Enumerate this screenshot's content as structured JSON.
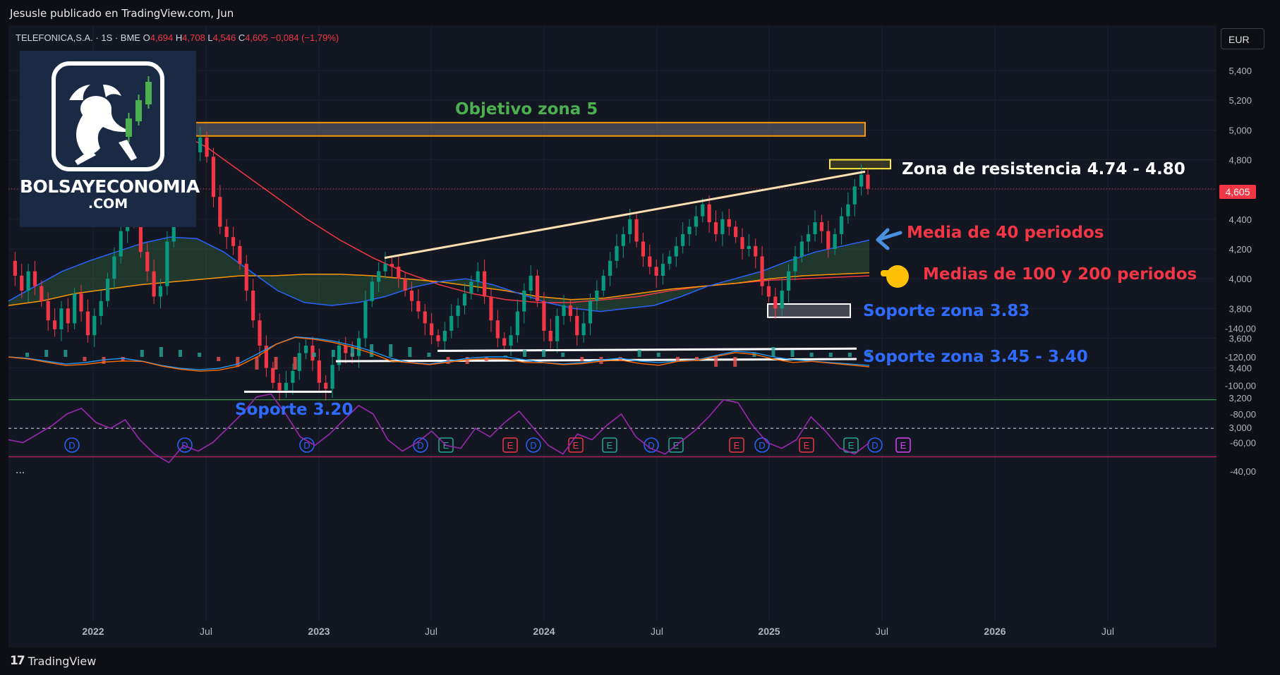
{
  "header": {
    "published_by": "Jesusle publicado en TradingView.com, Jun"
  },
  "footer": {
    "brand": "TradingView",
    "mark": "17"
  },
  "symbol": {
    "name": "TELEFONICA,S.A.",
    "interval": "1S",
    "exchange": "BME",
    "o_label": "O",
    "o": "4,694",
    "h_label": "H",
    "h": "4,708",
    "l_label": "L",
    "l": "4,546",
    "c_label": "C",
    "c": "4,605",
    "change": "−0,084 (−1,79%)"
  },
  "currency": "EUR",
  "last_price": "4,605",
  "logo": {
    "line1": "BOLSAYECONOMIA",
    "line2": ".COM"
  },
  "pane_menu": "...",
  "annotations": [
    {
      "id": "objetivo",
      "text": "Objetivo zona 5",
      "color": "#4caf50"
    },
    {
      "id": "resistencia",
      "text": "Zona de resistencia 4.74 - 4.80",
      "color": "#ffffff"
    },
    {
      "id": "media40",
      "text": "Media de 40 periodos",
      "color": "#f23645"
    },
    {
      "id": "medias100200",
      "text": "Medias de 100 y 200 periodos",
      "color": "#f23645"
    },
    {
      "id": "soporte383",
      "text": "Soporte zona 3.83",
      "color": "#2f6bff"
    },
    {
      "id": "soporte345",
      "text": "Soporte zona 3.45 - 3.40",
      "color": "#2f6bff"
    },
    {
      "id": "soporte320",
      "text": "Soporte 3.20",
      "color": "#2f6bff"
    }
  ],
  "chart_data": {
    "type": "candlestick",
    "colors": {
      "up": "#089981",
      "down": "#f23645",
      "sma40": "#2962ff",
      "sma100": "#ff9800",
      "sma200": "#f23645",
      "rsi": "#9c27b0",
      "macd": "#2196f3",
      "signal": "#ff6d00"
    },
    "price_axis": {
      "min": 3.0,
      "max": 5.4,
      "ticks": [
        "5,400",
        "5,200",
        "5,000",
        "4,800",
        "4,600",
        "4,400",
        "4,200",
        "4,000",
        "3,800",
        "3,600",
        "3,400",
        "3,200",
        "3,000"
      ]
    },
    "time_axis": {
      "ticks": [
        "2022",
        "Jul",
        "2023",
        "Jul",
        "2024",
        "Jul",
        "2025",
        "Jul",
        "2026",
        "Jul"
      ]
    },
    "indicator_axis": {
      "ticks": [
        "-40,00",
        "-60,00",
        "-80,00",
        "-100,00",
        "-120,00",
        "-140,00"
      ]
    },
    "close_series": [
      4.12,
      4.02,
      3.92,
      4.05,
      3.95,
      3.85,
      3.72,
      3.66,
      3.8,
      3.7,
      3.9,
      3.78,
      3.62,
      3.75,
      3.85,
      4.0,
      4.15,
      4.32,
      4.55,
      4.4,
      4.18,
      4.05,
      3.88,
      3.95,
      4.25,
      4.45,
      4.6,
      4.72,
      4.85,
      4.95,
      4.82,
      4.55,
      4.35,
      4.28,
      4.22,
      4.1,
      3.92,
      3.72,
      3.55,
      3.4,
      3.3,
      3.25,
      3.3,
      3.38,
      3.5,
      3.55,
      3.45,
      3.3,
      3.26,
      3.42,
      3.55,
      3.5,
      3.48,
      3.6,
      3.85,
      3.98,
      4.05,
      4.1,
      4.08,
      4.0,
      3.92,
      3.85,
      3.78,
      3.7,
      3.62,
      3.58,
      3.65,
      3.75,
      3.82,
      3.9,
      3.98,
      4.05,
      3.88,
      3.72,
      3.6,
      3.55,
      3.62,
      3.78,
      3.92,
      4.02,
      3.85,
      3.65,
      3.58,
      3.75,
      3.82,
      3.75,
      3.62,
      3.7,
      3.85,
      3.92,
      4.02,
      4.12,
      4.22,
      4.3,
      4.4,
      4.25,
      4.15,
      4.08,
      4.02,
      4.1,
      4.15,
      4.22,
      4.3,
      4.35,
      4.42,
      4.5,
      4.38,
      4.3,
      4.4,
      4.35,
      4.28,
      4.2,
      4.22,
      4.15,
      3.95,
      3.88,
      3.8,
      3.92,
      4.05,
      4.15,
      4.25,
      4.3,
      4.38,
      4.32,
      4.2,
      4.3,
      4.42,
      4.5,
      4.62,
      4.7,
      4.605
    ],
    "sma40": [
      3.85,
      3.95,
      4.05,
      4.12,
      4.18,
      4.24,
      4.28,
      4.27,
      4.18,
      4.05,
      3.92,
      3.84,
      3.82,
      3.84,
      3.88,
      3.94,
      3.98,
      4.0,
      3.96,
      3.9,
      3.84,
      3.8,
      3.78,
      3.8,
      3.82,
      3.88,
      3.95,
      4.0,
      4.05,
      4.12,
      4.18,
      4.22,
      4.26
    ],
    "sma100": [
      3.82,
      3.85,
      3.9,
      3.93,
      3.96,
      3.98,
      4.0,
      4.02,
      4.02,
      4.03,
      4.03,
      4.02,
      4.0,
      3.98,
      3.95,
      3.92,
      3.88,
      3.86,
      3.87,
      3.9,
      3.93,
      3.95,
      3.97,
      4.0,
      4.02,
      4.03,
      4.04
    ],
    "sma200": [
      5.4,
      5.3,
      5.2,
      5.1,
      5.0,
      4.88,
      4.72,
      4.56,
      4.4,
      4.26,
      4.14,
      4.04,
      3.96,
      3.9,
      3.86,
      3.84,
      3.84,
      3.86,
      3.88,
      3.92,
      3.95,
      3.97,
      3.99,
      4.0,
      4.01,
      4.02
    ],
    "resistance_box": [
      4.74,
      4.8
    ],
    "target_zone_5": [
      4.96,
      5.05
    ],
    "support_383": [
      3.75,
      3.83
    ],
    "support_345_340": [
      3.45,
      3.4
    ],
    "support_320": 3.2,
    "events": [
      "D",
      "D",
      "D",
      "D",
      "E",
      "E",
      "D",
      "E",
      "E",
      "D",
      "E",
      "E",
      "D",
      "E",
      "E",
      "D",
      "E"
    ],
    "rsi": [
      -62,
      -60,
      -66,
      -72,
      -80,
      -84,
      -74,
      -70,
      -76,
      -62,
      -52,
      -46,
      -58,
      -54,
      -60,
      -70,
      -80,
      -92,
      -94,
      -80,
      -64,
      -58,
      -66,
      -76,
      -86,
      -80,
      -62,
      -54,
      -60,
      -68,
      -58,
      -56,
      -70,
      -64,
      -74,
      -82,
      -70,
      -58,
      -52,
      -66,
      -62,
      -72,
      -80,
      -64,
      -56,
      -52,
      -60,
      -68,
      -78,
      -90,
      -88,
      -72,
      -60,
      -56,
      -62,
      -78,
      -68,
      -56,
      -52,
      -60
    ],
    "macd": [
      -120,
      -119,
      -117,
      -115,
      -116,
      -118,
      -119,
      -117,
      -114,
      -112,
      -111,
      -112,
      -115,
      -122,
      -129,
      -134,
      -133,
      -131,
      -128,
      -124,
      -119,
      -116,
      -115,
      -117,
      -119,
      -120,
      -120,
      -118,
      -116,
      -115,
      -116,
      -118,
      -119,
      -117,
      -116,
      -117,
      -118,
      -121,
      -124,
      -123,
      -120,
      -118,
      -117,
      -116,
      -115,
      -114
    ]
  }
}
